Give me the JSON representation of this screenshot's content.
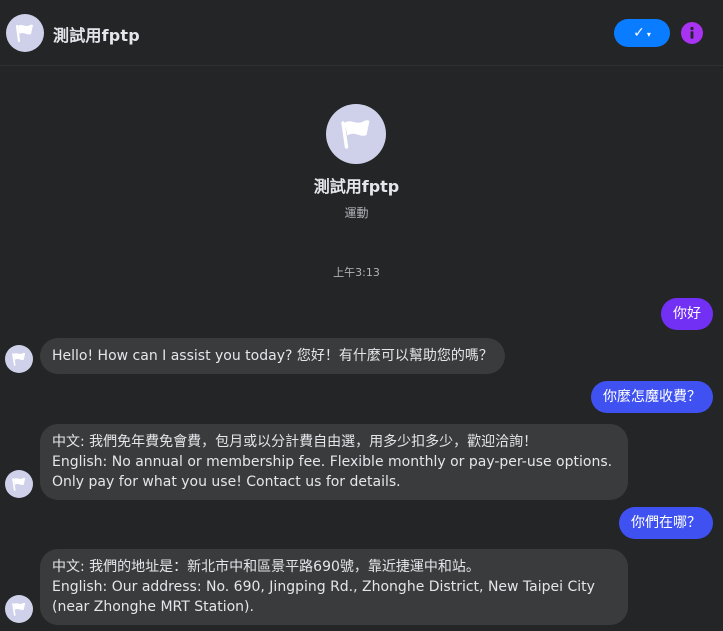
{
  "header": {
    "title": "測試用fptp",
    "verify_label": "✓",
    "verify_caret": "▾"
  },
  "profile": {
    "name": "測試用fptp",
    "category": "運動"
  },
  "conversation": {
    "timestamp": "上午3:13",
    "messages": [
      {
        "from": "user",
        "text": "你好"
      },
      {
        "from": "page",
        "lines": [
          "Hello! How can I assist you today? 您好！有什麼可以幫助您的嗎？"
        ]
      },
      {
        "from": "user",
        "text": "你麼怎魔收費？"
      },
      {
        "from": "page",
        "lines": [
          "中文: 我們免年費免會費，包月或以分計費自由選，用多少扣多少，歡迎洽詢！",
          "English: No annual or membership fee. Flexible monthly or pay-per-use options.",
          "Only pay for what you use! Contact us for details."
        ]
      },
      {
        "from": "user",
        "text": "你們在哪？"
      },
      {
        "from": "page",
        "lines": [
          "中文: 我們的地址是：新北市中和區景平路690號，靠近捷運中和站。",
          "English: Our address: No. 690, Jingping Rd., Zhonghe District, New Taipei City",
          "(near Zhonghe MRT Station)."
        ]
      }
    ]
  },
  "colors": {
    "background": "#242526",
    "user_bubble_purple": "#7230f5",
    "user_bubble_blue": "#3f52f1",
    "page_bubble": "#3a3b3c",
    "verify_button": "#0a7cff",
    "info_button": "#a933f2",
    "avatar_bg": "#cfd1ea"
  },
  "icons": {
    "avatar": "white-flag-icon",
    "info": "info-icon",
    "verify": "checkmark-icon"
  }
}
